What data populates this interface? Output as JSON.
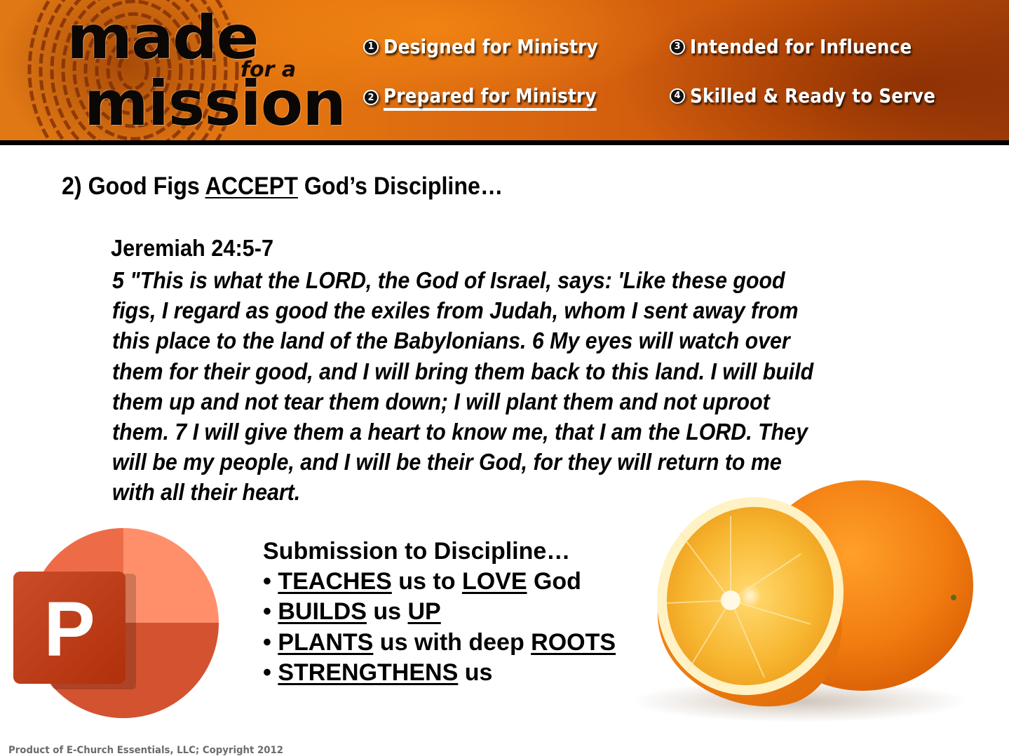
{
  "banner": {
    "logo": {
      "word1": "made",
      "connector": "for a",
      "word2": "mission"
    },
    "nav": [
      {
        "number": "1",
        "label": "Designed for Ministry",
        "active": false
      },
      {
        "number": "2",
        "label": "Prepared for Ministry",
        "active": true
      },
      {
        "number": "3",
        "label": "Intended for Influence",
        "active": false
      },
      {
        "number": "4",
        "label": "Skilled & Ready to Serve",
        "active": false
      }
    ],
    "colors": {
      "banner": "#d86410",
      "bar": "#000000",
      "nav_text": "#ffffff"
    }
  },
  "heading": {
    "prefix": "2) Good Figs ",
    "emphasis": "ACCEPT",
    "suffix": " God’s Discipline…"
  },
  "scripture": {
    "reference": "Jeremiah 24:5-7",
    "lines": [
      "5 \"This is what the LORD, the God of Israel, says: 'Like these good",
      "figs, I regard as good the exiles from Judah, whom I sent away from",
      "this place to the land of the Babylonians. 6 My eyes will watch over",
      "them for their good, and I will bring them back to this land. I will build",
      "them up and not tear them down; I will plant them and not uproot",
      "them. 7 I will give them a heart to know me, that I am the LORD. They",
      "will be my people, and I will be their God, for they will return to me",
      "with all their heart."
    ]
  },
  "submission": {
    "title": "Submission to Discipline…",
    "bullet": "•",
    "items": [
      {
        "parts": [
          {
            "text": "TEACHES",
            "u": true
          },
          {
            "text": " us to ",
            "u": false
          },
          {
            "text": "LOVE",
            "u": true
          },
          {
            "text": " God",
            "u": false
          }
        ]
      },
      {
        "parts": [
          {
            "text": "BUILDS",
            "u": true
          },
          {
            "text": " us ",
            "u": false
          },
          {
            "text": "UP",
            "u": true
          }
        ]
      },
      {
        "parts": [
          {
            "text": "PLANTS",
            "u": true
          },
          {
            "text": " us with deep ",
            "u": false
          },
          {
            "text": "ROOTS",
            "u": true
          }
        ]
      },
      {
        "parts": [
          {
            "text": "STRENGTHENS",
            "u": true
          },
          {
            "text": " us",
            "u": false
          }
        ]
      }
    ]
  },
  "images": {
    "ppt_logo_letter": "P",
    "orange_photo": "orange-halves-photo"
  },
  "footer": {
    "copyright": "Product of E-Church Essentials, LLC; Copyright 2012"
  }
}
